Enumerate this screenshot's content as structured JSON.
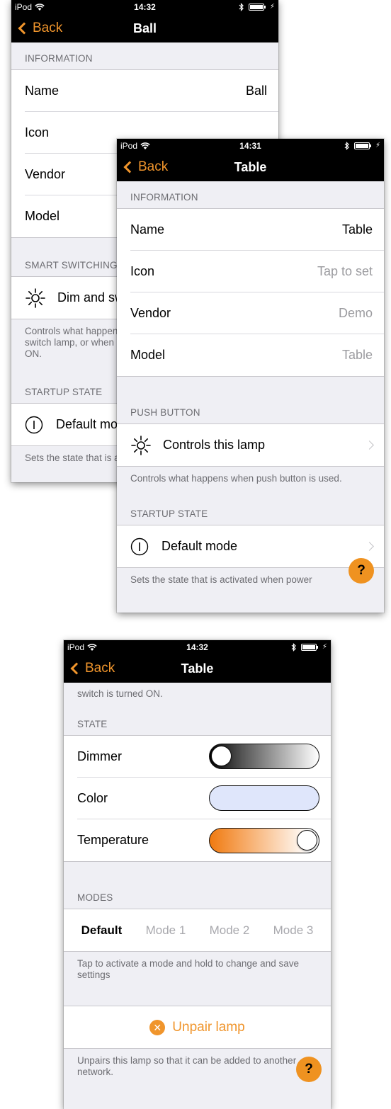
{
  "screen1": {
    "status": {
      "carrier": "iPod",
      "time": "14:32"
    },
    "nav": {
      "back": "Back",
      "title": "Ball"
    },
    "information_header": "INFORMATION",
    "info_rows": [
      {
        "label": "Name",
        "value": "Ball"
      },
      {
        "label": "Icon",
        "value": ""
      },
      {
        "label": "Vendor",
        "value": ""
      },
      {
        "label": "Model",
        "value": ""
      }
    ],
    "smart_header": "SMART SWITCHING",
    "smart_row": "Dim and switch",
    "smart_footer": "Controls what happens when a wall switch is used to switch lamp, or when switch is quickly flicked OFF and ON.",
    "startup_header": "STARTUP STATE",
    "startup_row": "Default mode",
    "startup_footer": "Sets the state that is activated when power"
  },
  "screen2": {
    "status": {
      "carrier": "iPod",
      "time": "14:31"
    },
    "nav": {
      "back": "Back",
      "title": "Table"
    },
    "information_header": "INFORMATION",
    "info_rows": [
      {
        "label": "Name",
        "value": "Table"
      },
      {
        "label": "Icon",
        "value": "Tap to set"
      },
      {
        "label": "Vendor",
        "value": "Demo"
      },
      {
        "label": "Model",
        "value": "Table"
      }
    ],
    "push_header": "PUSH BUTTON",
    "push_row": "Controls this lamp",
    "push_footer": "Controls what happens when push button is used.",
    "startup_header": "STARTUP STATE",
    "startup_row": "Default mode",
    "startup_footer": "Sets the state that is activated when power",
    "help": "?"
  },
  "screen3": {
    "status": {
      "carrier": "iPod",
      "time": "14:32"
    },
    "nav": {
      "back": "Back",
      "title": "Table"
    },
    "scroll_text": "switch is turned ON.",
    "state_header": "STATE",
    "state_rows": [
      {
        "label": "Dimmer",
        "level": 0.0
      },
      {
        "label": "Color"
      },
      {
        "label": "Temperature",
        "level": 1.0
      }
    ],
    "modes_header": "MODES",
    "modes": [
      "Default",
      "Mode 1",
      "Mode 2",
      "Mode 3"
    ],
    "active_mode": "Default",
    "modes_footer": "Tap to activate a mode and hold to change and save settings",
    "unpair_label": "Unpair lamp",
    "unpair_footer": "Unpairs this lamp so that it can be added to another network.",
    "help": "?"
  },
  "colors": {
    "accent": "#f0952c",
    "help_bg": "#ef9220",
    "color_slider": "#dfe6fb",
    "background": "#efeff4"
  }
}
